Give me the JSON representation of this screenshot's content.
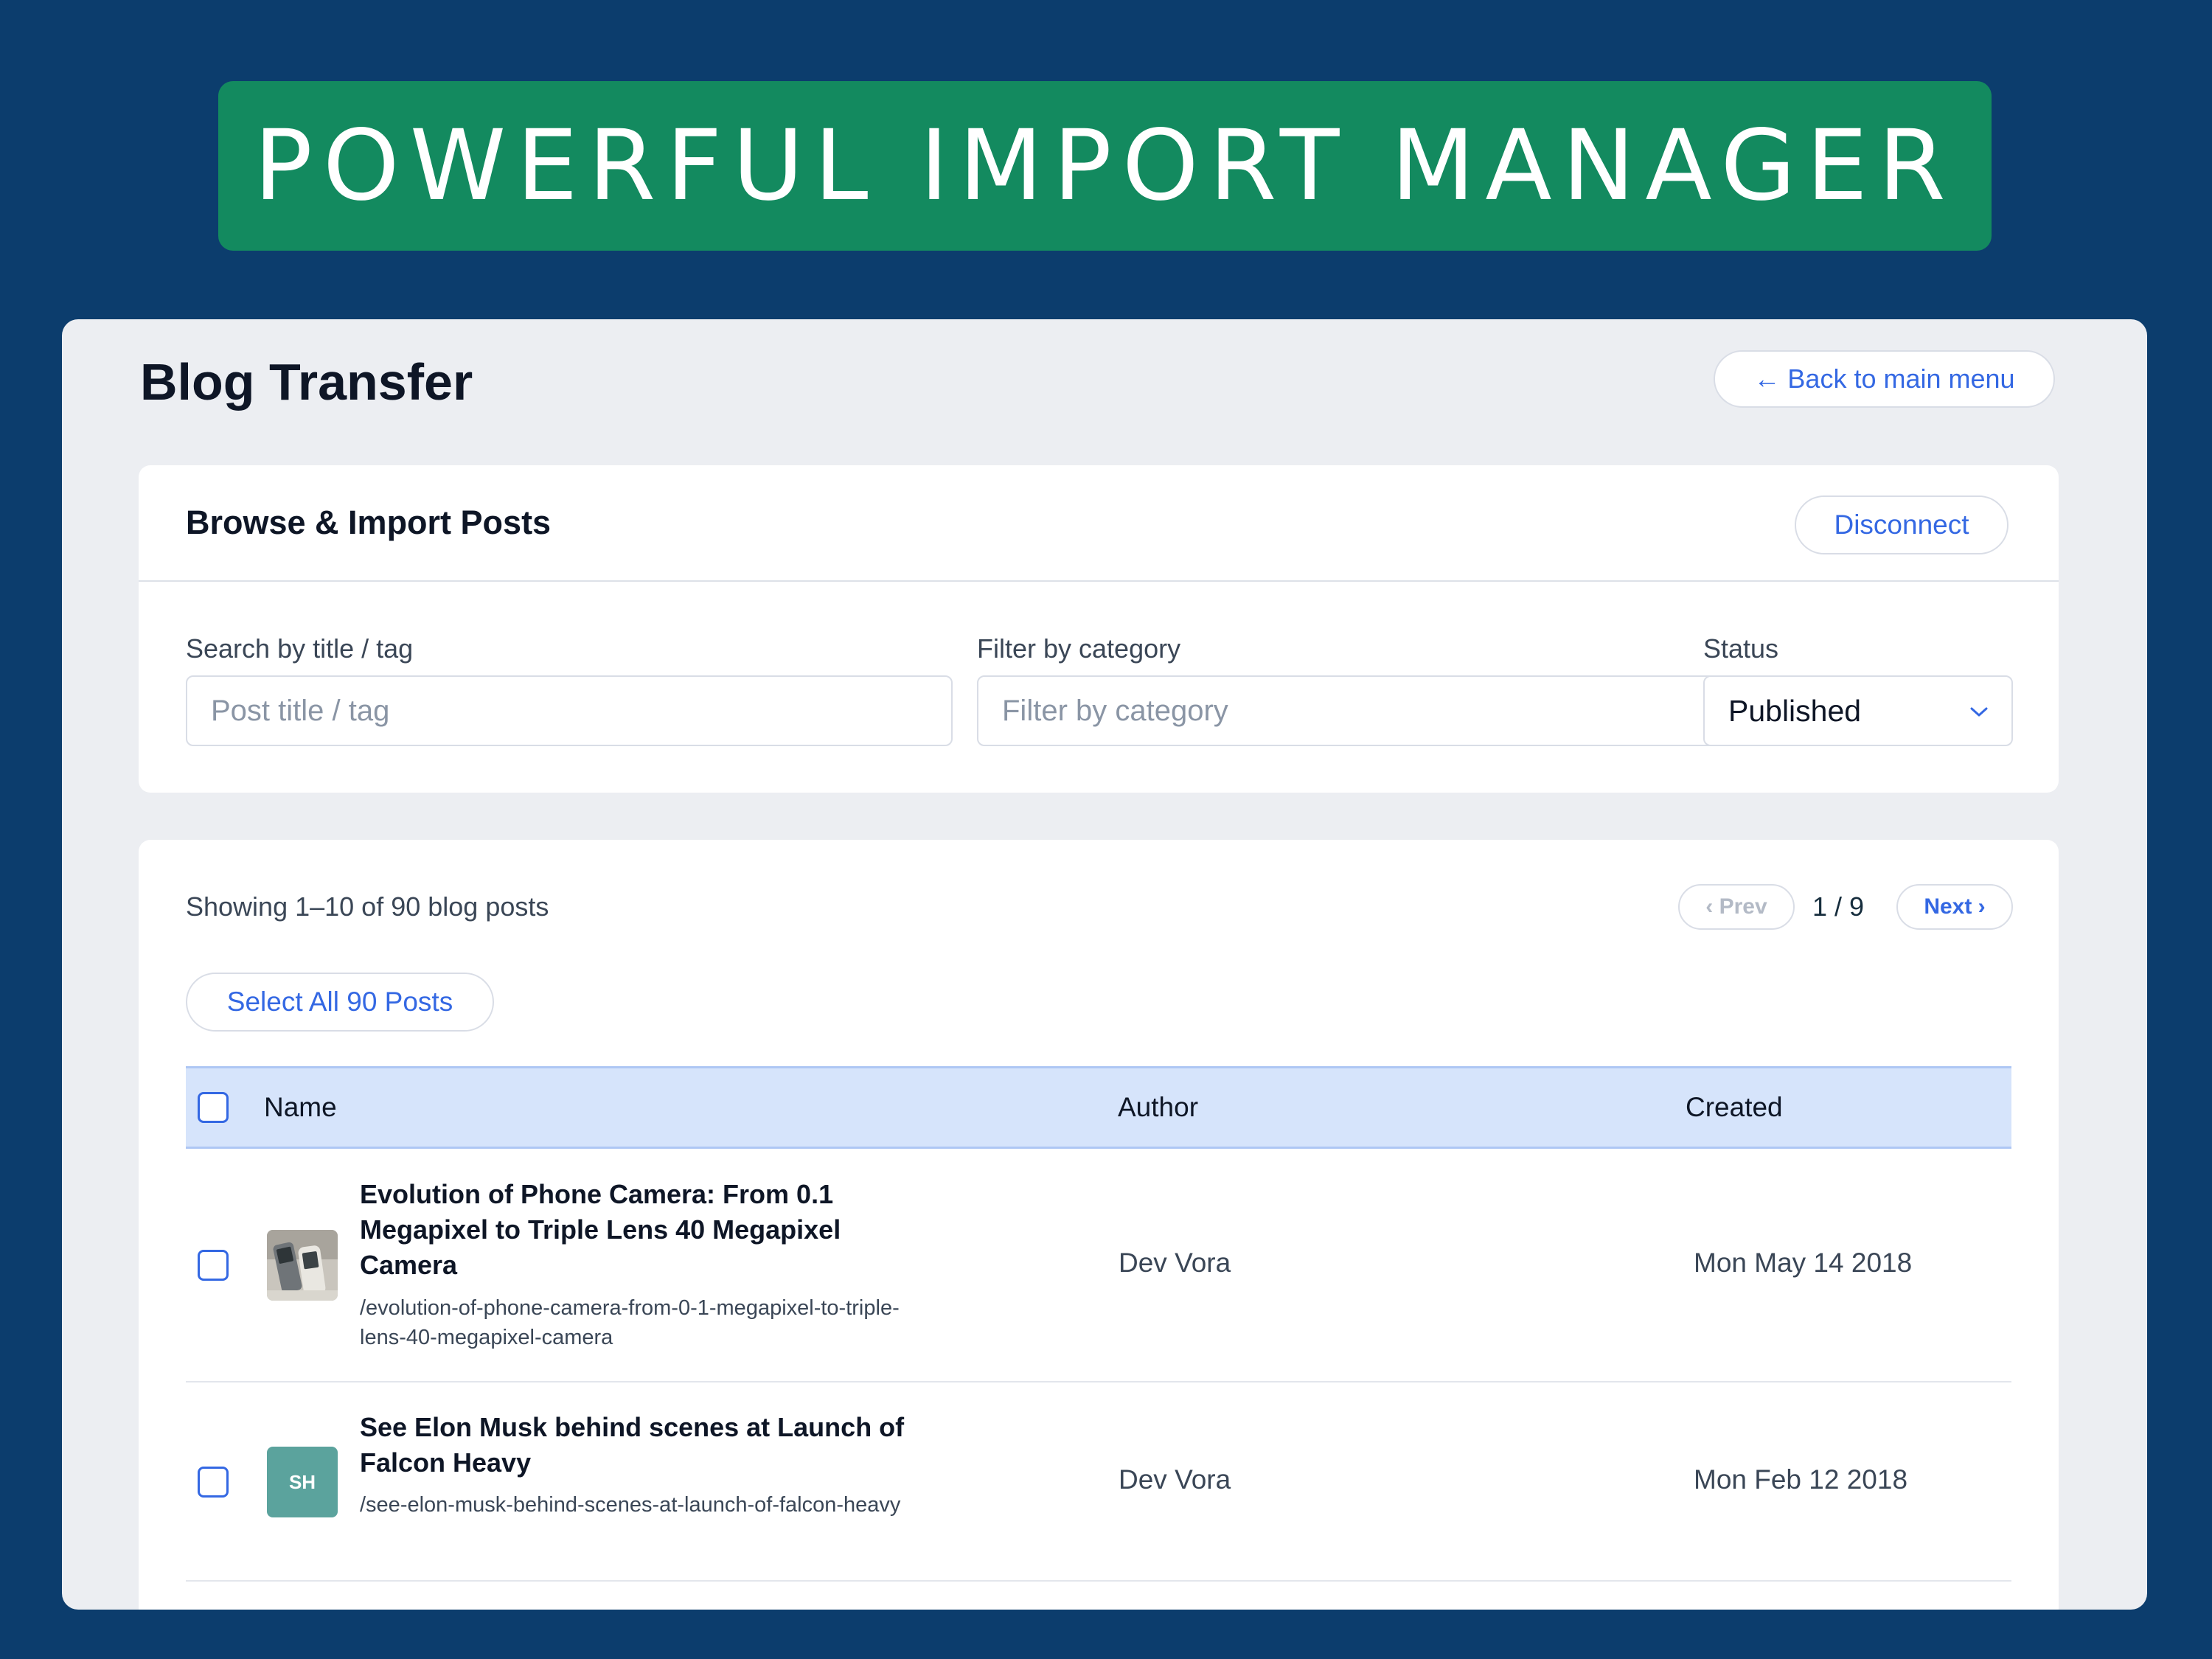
{
  "banner": {
    "title": "POWERFUL IMPORT MANAGER"
  },
  "page": {
    "title": "Blog Transfer",
    "back_label": "← Back to main menu"
  },
  "browse_card": {
    "title": "Browse & Import Posts",
    "disconnect_label": "Disconnect",
    "search": {
      "label": "Search by title / tag",
      "placeholder": "Post title / tag",
      "value": ""
    },
    "category": {
      "label": "Filter by category",
      "placeholder": "Filter by category",
      "value": ""
    },
    "status": {
      "label": "Status",
      "value": "Published"
    }
  },
  "list_card": {
    "showing_text": "Showing 1–10 of 90 blog posts",
    "pagination": {
      "prev_label": "‹ Prev",
      "page_indicator": "1 / 9",
      "next_label": "Next ›"
    },
    "select_all_label": "Select All 90 Posts",
    "columns": {
      "name": "Name",
      "author": "Author",
      "created": "Created"
    },
    "rows": [
      {
        "title": "Evolution of Phone Camera: From 0.1 Megapixel to Triple Lens 40 Megapixel Camera",
        "slug": "/evolution-of-phone-camera-from-0-1-megapixel-to-triple-lens-40-megapixel-camera",
        "author": "Dev Vora",
        "created": "Mon May 14 2018",
        "thumb": "photo-thumbnail"
      },
      {
        "title": "See Elon Musk behind scenes at Launch of Falcon Heavy",
        "slug": "/see-elon-musk-behind-scenes-at-launch-of-falcon-heavy",
        "author": "Dev Vora",
        "created": "Mon Feb 12 2018",
        "thumb_initials": "SH"
      }
    ]
  },
  "colors": {
    "background": "#0c3d6d",
    "banner": "#138a5f",
    "accent": "#3468e3",
    "table_header": "#d6e4fb",
    "initials_avatar": "#5ba39d"
  }
}
